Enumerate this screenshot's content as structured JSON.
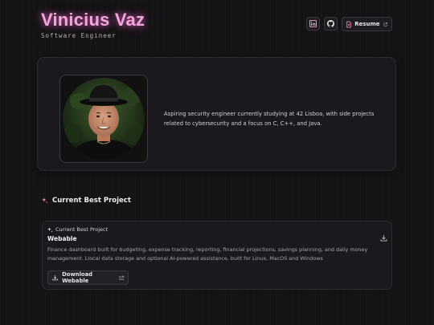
{
  "header": {
    "name": "Vinicius Vaz",
    "subtitle": "Software Engineer",
    "linkedin_icon": "linkedin-icon",
    "github_icon": "github-icon",
    "resume_label": "Resume"
  },
  "profile": {
    "bio": "Aspiring security engineer currently studying at 42 Lisboa, with side projects related to cybersecurity and a focus on C, C++, and Java."
  },
  "section": {
    "title": "Current Best Project"
  },
  "project": {
    "kicker": "Current Best Project",
    "title": "Webable",
    "description": "Finance dashboard built for budgeting, expense tracking, reporting, financial projections, savings planning, and daily money management. Llocal data storage and optional AI-powered assistance, built for Linux, MacOS and Windows",
    "download_label": "Download Webable"
  },
  "colors": {
    "accent_pink": "#f2a5dc",
    "background": "#151316",
    "card": "#1b191d"
  }
}
